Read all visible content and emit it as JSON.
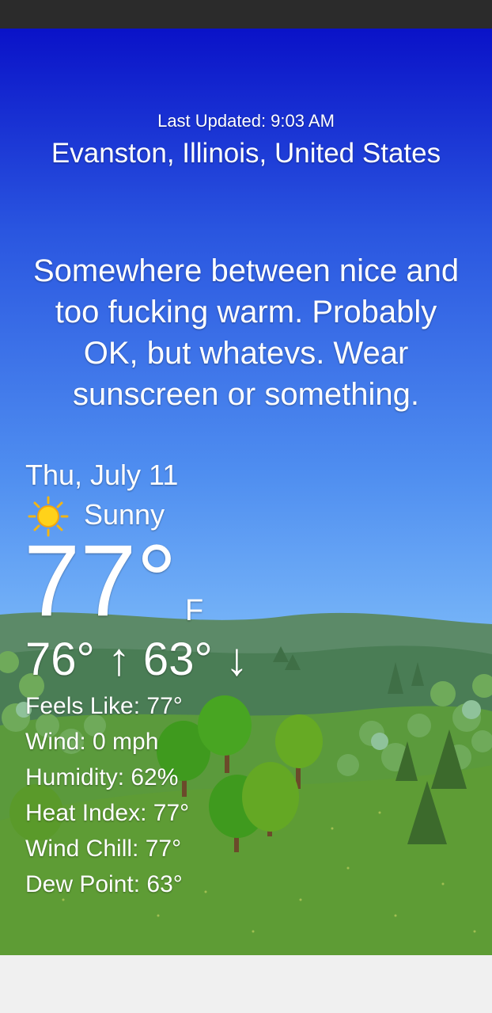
{
  "header": {
    "last_updated": "Last Updated: 9:03 AM",
    "location": "Evanston, Illinois, United States"
  },
  "message": "Somewhere between nice and too fucking warm. Probably OK, but whatevs. Wear sunscreen or something.",
  "forecast": {
    "date": "Thu, July 11",
    "condition_icon": "sun-icon",
    "condition": "Sunny",
    "temperature": "77°",
    "unit": "F",
    "hi_lo": "76° ↑ 63° ↓"
  },
  "details": [
    "Feels Like: 77°",
    "Wind: 0 mph",
    "Humidity: 62%",
    "Heat Index: 77°",
    "Wind Chill: 77°",
    "Dew Point: 63°"
  ],
  "colors": {
    "sky_top": "#0a12c8",
    "sky_bottom": "#9fd0fa",
    "grass": "#4f8a33",
    "sun": "#ffd21a"
  }
}
